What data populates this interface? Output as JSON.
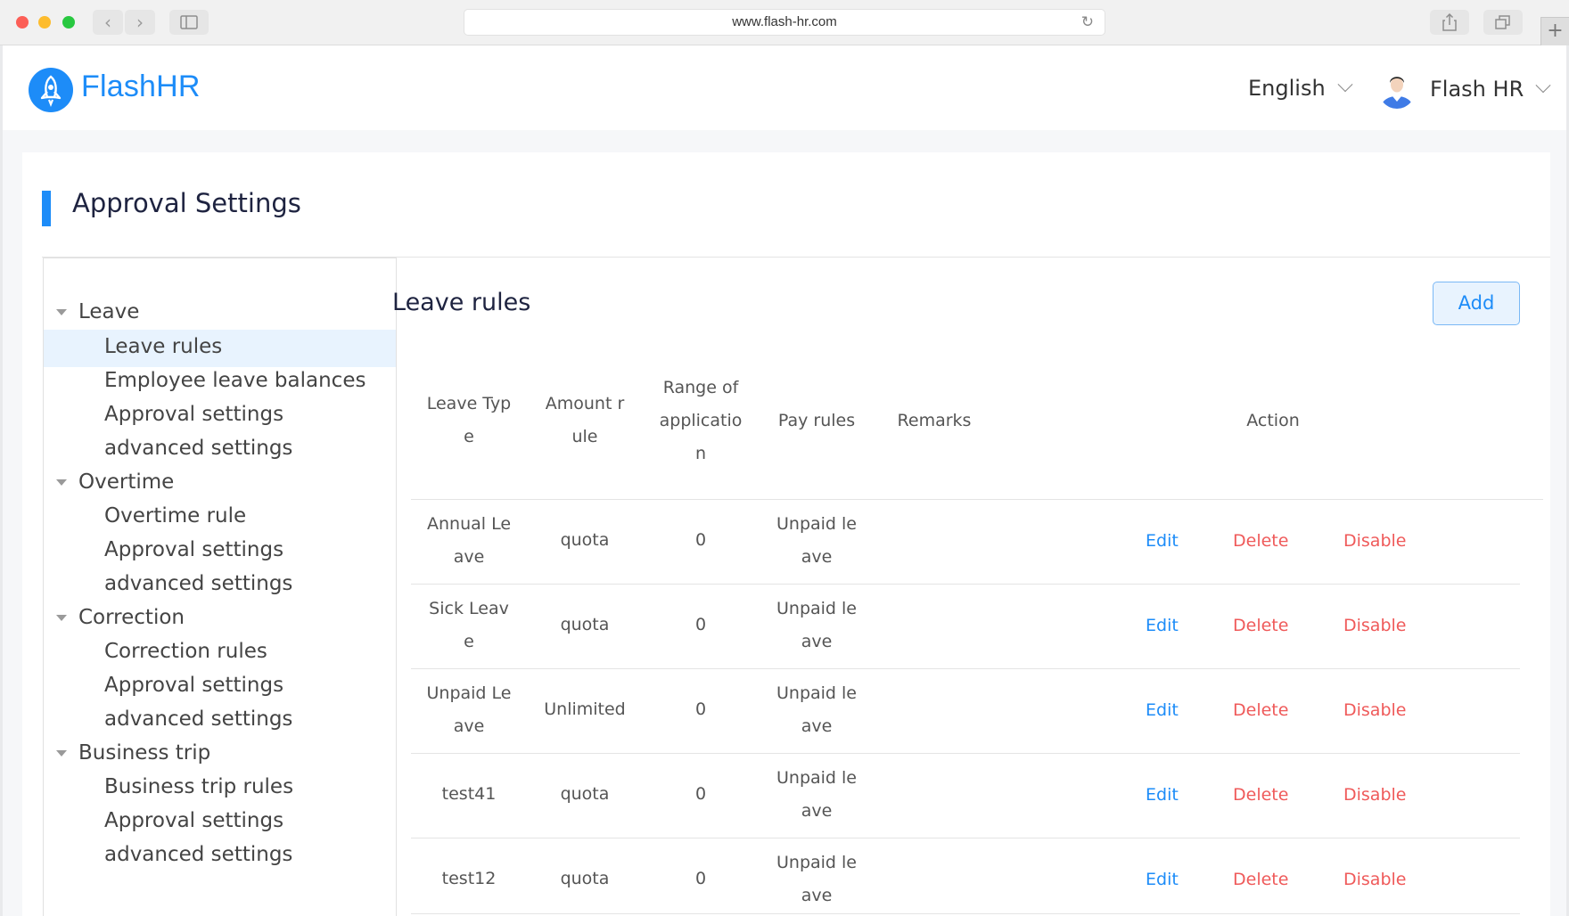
{
  "browser": {
    "url": "www.flash-hr.com"
  },
  "header": {
    "app_name": "FlashHR",
    "language": "English",
    "user_name": "Flash HR"
  },
  "page": {
    "title": "Approval Settings"
  },
  "sidebar": {
    "groups": [
      {
        "label": "Leave",
        "items": [
          "Leave rules",
          "Employee leave balances",
          "Approval settings",
          "advanced settings"
        ]
      },
      {
        "label": "Overtime",
        "items": [
          "Overtime rule",
          "Approval settings",
          "advanced settings"
        ]
      },
      {
        "label": "Correction",
        "items": [
          "Correction rules",
          "Approval settings",
          "advanced settings"
        ]
      },
      {
        "label": "Business trip",
        "items": [
          "Business trip rules",
          "Approval settings",
          "advanced settings"
        ]
      }
    ],
    "active_item": "Leave rules"
  },
  "main": {
    "title": "Leave rules",
    "add_label": "Add",
    "table": {
      "headers": [
        "Leave Typ e",
        "Amount r ule",
        "Range of applicatio n",
        "Pay rules",
        "Remarks",
        "Action"
      ],
      "header_lines": [
        [
          "Leave Typ",
          "e"
        ],
        [
          "Amount r",
          "ule"
        ],
        [
          "Range of",
          "applicatio",
          "n"
        ],
        [
          "Pay rules"
        ],
        [
          "Remarks"
        ],
        [
          "Action"
        ]
      ],
      "rows": [
        {
          "type_lines": [
            "Annual Le",
            "ave"
          ],
          "amount": "quota",
          "range": "0",
          "pay_lines": [
            "Unpaid le",
            "ave"
          ],
          "remarks": ""
        },
        {
          "type_lines": [
            "Sick Leav",
            "e"
          ],
          "amount": "quota",
          "range": "0",
          "pay_lines": [
            "Unpaid le",
            "ave"
          ],
          "remarks": ""
        },
        {
          "type_lines": [
            "Unpaid Le",
            "ave"
          ],
          "amount": "Unlimited",
          "range": "0",
          "pay_lines": [
            "Unpaid le",
            "ave"
          ],
          "remarks": ""
        },
        {
          "type_lines": [
            "test41"
          ],
          "amount": "quota",
          "range": "0",
          "pay_lines": [
            "Unpaid le",
            "ave"
          ],
          "remarks": ""
        },
        {
          "type_lines": [
            "test12"
          ],
          "amount": "quota",
          "range": "0",
          "pay_lines": [
            "Unpaid le",
            "ave"
          ],
          "remarks": ""
        }
      ],
      "actions": {
        "edit": "Edit",
        "delete": "Delete",
        "disable": "Disable"
      }
    }
  },
  "colors": {
    "brand": "#1d8cf8",
    "danger": "#ef5a5a",
    "active_bg": "#e8f3fe"
  },
  "icons": [
    "rocket-logo-icon",
    "user-avatar-icon",
    "chevron-down-icon",
    "caret-down-icon",
    "reload-icon",
    "share-icon",
    "tabs-icon",
    "sidebar-toggle-icon"
  ]
}
